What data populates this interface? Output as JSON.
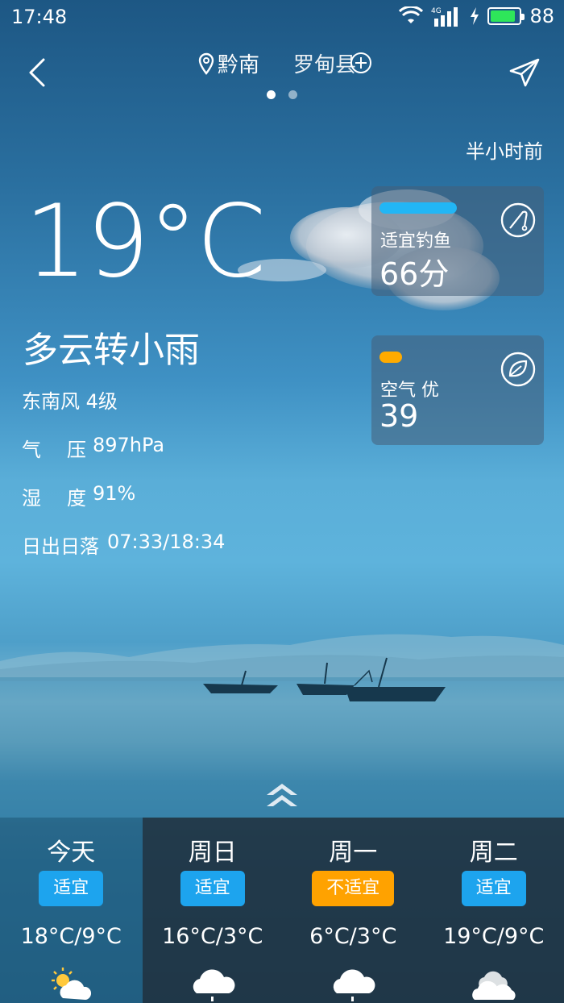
{
  "status": {
    "time": "17:48",
    "network": "4G",
    "battery": "88",
    "battery_level": 0.88
  },
  "header": {
    "locations": [
      "黔南",
      "罗甸县"
    ],
    "active_page": 0,
    "page_count": 2
  },
  "weather": {
    "updated": "半小时前",
    "temperature": "19°C",
    "condition": "多云转小雨",
    "wind": "东南风 4级",
    "pressure_label": [
      "气",
      "压"
    ],
    "pressure_value": "897hPa",
    "humidity_label": [
      "湿",
      "度"
    ],
    "humidity_value": "91%",
    "sun_label": "日出日落",
    "sun_value": "07:33/18:34"
  },
  "cards": {
    "fishing": {
      "title": "适宜钓鱼",
      "value": "66分",
      "bar_color": "#22b6f5",
      "icon": "fishing-rod-icon"
    },
    "air": {
      "title": "空气 优",
      "value": "39",
      "bar_color": "#ffab00",
      "icon": "leaf-icon"
    }
  },
  "forecast": [
    {
      "day": "今天",
      "status": "适宜",
      "temp": "18°C/9°C",
      "icon": "partly-sunny-icon",
      "suitable": true
    },
    {
      "day": "周日",
      "status": "适宜",
      "temp": "16°C/3°C",
      "icon": "rain-cloud-icon",
      "suitable": true
    },
    {
      "day": "周一",
      "status": "不适宜",
      "temp": "6°C/3°C",
      "icon": "rain-cloud-icon",
      "suitable": false
    },
    {
      "day": "周二",
      "status": "适宜",
      "temp": "19°C/9°C",
      "icon": "cloudy-icon",
      "suitable": true
    }
  ],
  "colors": {
    "suitable": "#1da4ee",
    "unsuitable": "#ffa200"
  }
}
